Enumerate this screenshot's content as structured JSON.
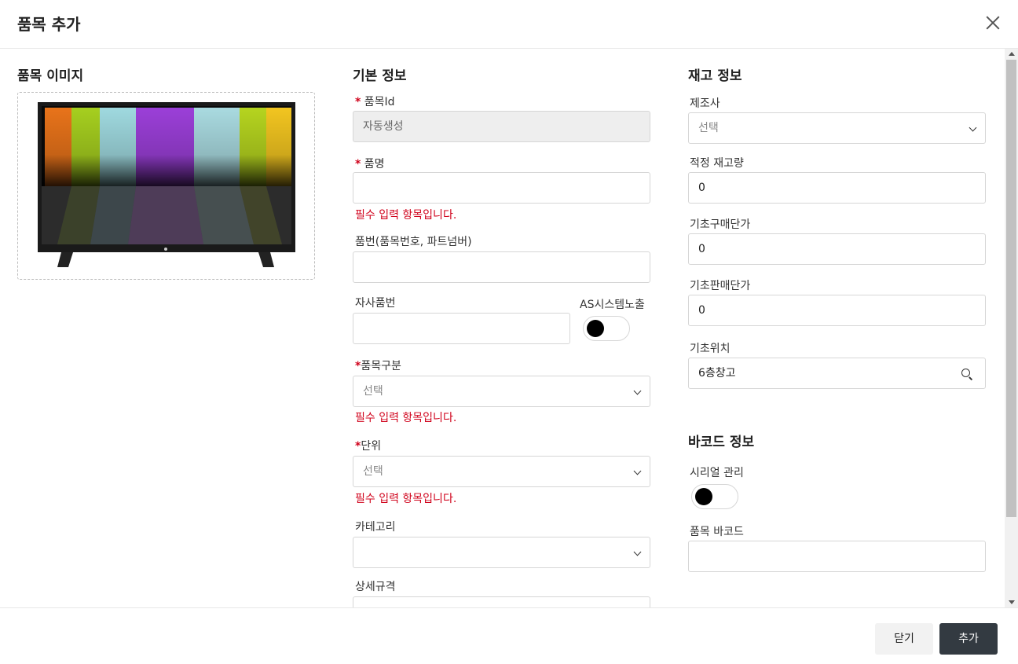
{
  "header": {
    "title": "품목 추가"
  },
  "image_section": {
    "title": "품목 이미지"
  },
  "basic_info": {
    "title": "기본 정보",
    "item_id": {
      "label": "품목Id",
      "value": "자동생성"
    },
    "item_name": {
      "label": "품명",
      "value": "",
      "error": "필수 입력 항목입니다."
    },
    "part_number": {
      "label": "품번(품목번호, 파트넘버)",
      "value": ""
    },
    "own_part_number": {
      "label": "자사품번",
      "value": ""
    },
    "as_system_exposure": {
      "label": "AS시스템노출"
    },
    "item_category": {
      "label": "품목구분",
      "placeholder": "선택",
      "error": "필수 입력 항목입니다."
    },
    "unit": {
      "label": "단위",
      "placeholder": "선택",
      "error": "필수 입력 항목입니다."
    },
    "category": {
      "label": "카테고리",
      "value": ""
    },
    "detail_spec": {
      "label": "상세규격"
    },
    "required_mark": "*"
  },
  "stock_info": {
    "title": "재고 정보",
    "manufacturer": {
      "label": "제조사",
      "placeholder": "선택"
    },
    "proper_stock": {
      "label": "적정 재고량",
      "value": "0"
    },
    "base_purchase_price": {
      "label": "기초구매단가",
      "value": "0"
    },
    "base_sale_price": {
      "label": "기초판매단가",
      "value": "0"
    },
    "base_location": {
      "label": "기초위치",
      "value": "6층창고"
    }
  },
  "barcode_info": {
    "title": "바코드 정보",
    "serial_management": {
      "label": "시리얼 관리"
    },
    "item_barcode": {
      "label": "품목 바코드",
      "value": ""
    }
  },
  "footer": {
    "close_label": "닫기",
    "add_label": "추가"
  },
  "colors": {
    "required": "#d0021b",
    "primary_button": "#333a41"
  }
}
